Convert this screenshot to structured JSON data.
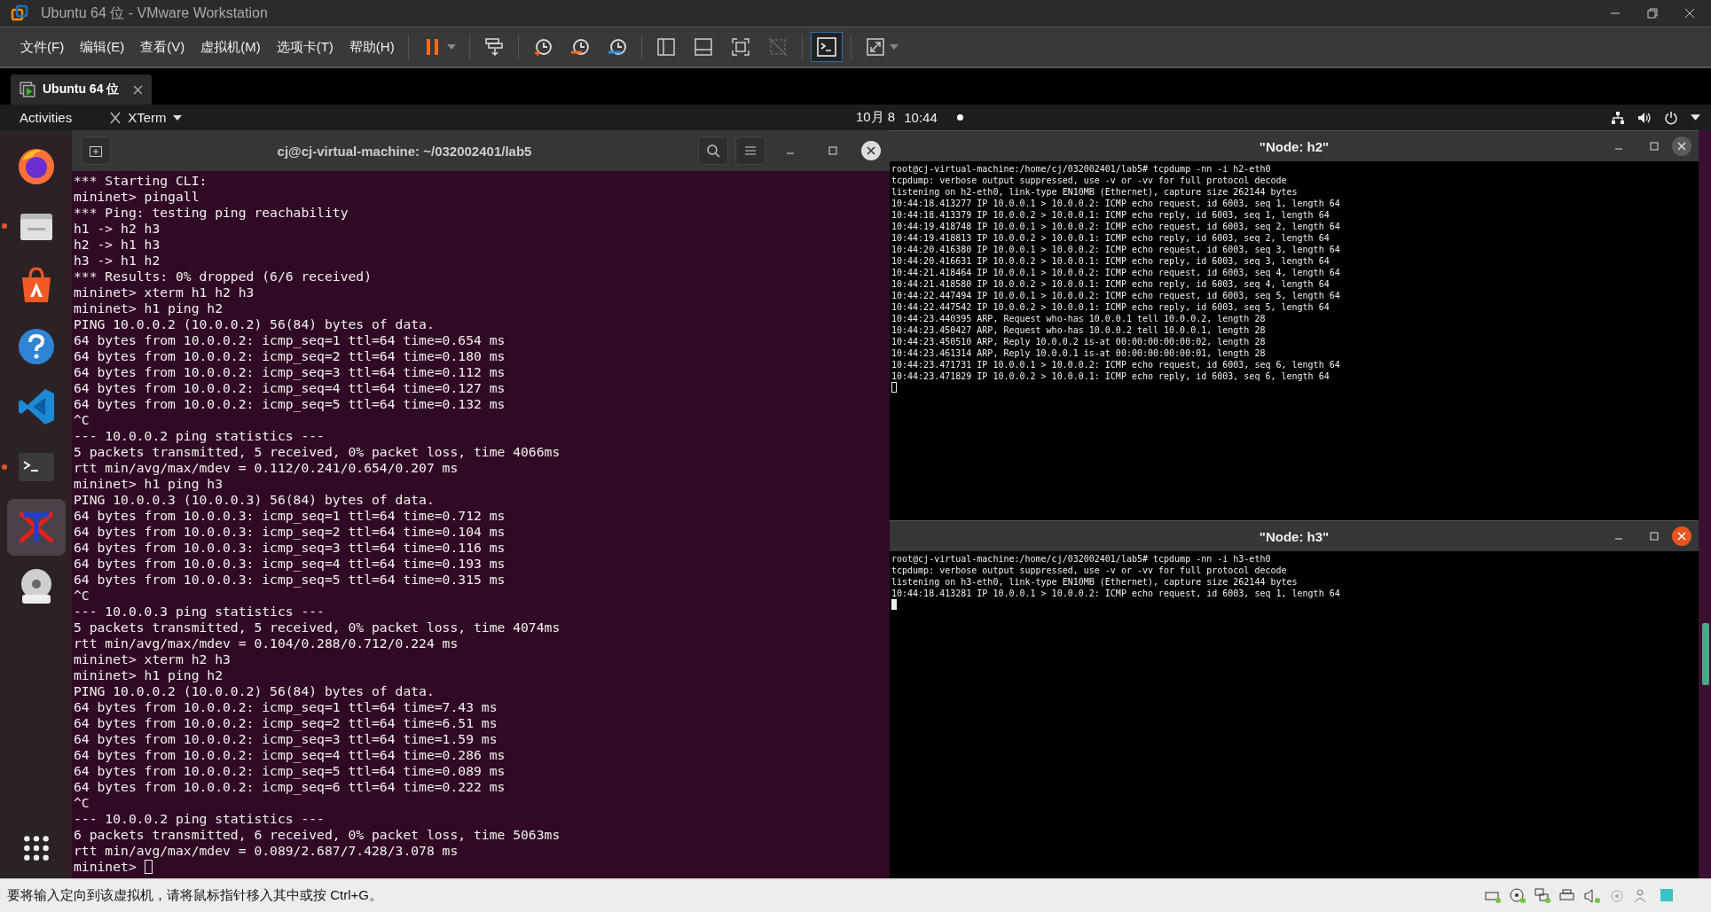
{
  "window": {
    "title": "Ubuntu 64 位 - VMware Workstation"
  },
  "menu": [
    "文件(F)",
    "编辑(E)",
    "查看(V)",
    "虚拟机(M)",
    "选项卡(T)",
    "帮助(H)"
  ],
  "toolbar_groups": [
    {
      "buttons": [
        {
          "kind": "pause",
          "selected": false,
          "dropdown": true
        }
      ]
    },
    {
      "buttons": [
        {
          "kind": "send-keys",
          "selected": false,
          "dropdown": false
        }
      ]
    },
    {
      "buttons": [
        {
          "kind": "snapshot-take",
          "selected": false,
          "dropdown": false
        },
        {
          "kind": "snapshot-revert",
          "selected": false,
          "dropdown": false
        },
        {
          "kind": "snapshot-manager",
          "selected": false,
          "dropdown": false
        }
      ]
    },
    {
      "buttons": [
        {
          "kind": "library",
          "selected": false,
          "dropdown": false
        },
        {
          "kind": "thumbnail",
          "selected": false,
          "dropdown": false
        },
        {
          "kind": "fullscreen",
          "selected": false,
          "dropdown": false
        },
        {
          "kind": "unity",
          "selected": false,
          "dropdown": false
        }
      ]
    },
    {
      "buttons": [
        {
          "kind": "console",
          "selected": true,
          "dropdown": false
        }
      ]
    },
    {
      "buttons": [
        {
          "kind": "stretch",
          "selected": false,
          "dropdown": true
        }
      ]
    }
  ],
  "vm_tabs": [
    {
      "label": "Ubuntu 64 位",
      "selected": true
    }
  ],
  "top_bar": {
    "activities": "Activities",
    "app": "XTerm",
    "date": "10月 8",
    "time": "10:44"
  },
  "dock": [
    {
      "kind": "firefox",
      "running": false,
      "selected": false
    },
    {
      "kind": "files",
      "running": true,
      "selected": false
    },
    {
      "kind": "software",
      "running": false,
      "selected": false
    },
    {
      "kind": "help",
      "running": false,
      "selected": false
    },
    {
      "kind": "vscode",
      "running": false,
      "selected": false
    },
    {
      "kind": "terminal",
      "running": true,
      "selected": false
    },
    {
      "kind": "xterm",
      "running": false,
      "selected": true
    },
    {
      "kind": "dvd",
      "running": false,
      "selected": false
    }
  ],
  "terminal": {
    "title": "cj@cj-virtual-machine: ~/032002401/lab5",
    "lines": [
      "*** Starting CLI:",
      "mininet> pingall",
      "*** Ping: testing ping reachability",
      "h1 -> h2 h3",
      "h2 -> h1 h3",
      "h3 -> h1 h2",
      "*** Results: 0% dropped (6/6 received)",
      "mininet> xterm h1 h2 h3",
      "mininet> h1 ping h2",
      "PING 10.0.0.2 (10.0.0.2) 56(84) bytes of data.",
      "64 bytes from 10.0.0.2: icmp_seq=1 ttl=64 time=0.654 ms",
      "64 bytes from 10.0.0.2: icmp_seq=2 ttl=64 time=0.180 ms",
      "64 bytes from 10.0.0.2: icmp_seq=3 ttl=64 time=0.112 ms",
      "64 bytes from 10.0.0.2: icmp_seq=4 ttl=64 time=0.127 ms",
      "64 bytes from 10.0.0.2: icmp_seq=5 ttl=64 time=0.132 ms",
      "^C",
      "--- 10.0.0.2 ping statistics ---",
      "5 packets transmitted, 5 received, 0% packet loss, time 4066ms",
      "rtt min/avg/max/mdev = 0.112/0.241/0.654/0.207 ms",
      "mininet> h1 ping h3",
      "PING 10.0.0.3 (10.0.0.3) 56(84) bytes of data.",
      "64 bytes from 10.0.0.3: icmp_seq=1 ttl=64 time=0.712 ms",
      "64 bytes from 10.0.0.3: icmp_seq=2 ttl=64 time=0.104 ms",
      "64 bytes from 10.0.0.3: icmp_seq=3 ttl=64 time=0.116 ms",
      "64 bytes from 10.0.0.3: icmp_seq=4 ttl=64 time=0.193 ms",
      "64 bytes from 10.0.0.3: icmp_seq=5 ttl=64 time=0.315 ms",
      "^C",
      "--- 10.0.0.3 ping statistics ---",
      "5 packets transmitted, 5 received, 0% packet loss, time 4074ms",
      "rtt min/avg/max/mdev = 0.104/0.288/0.712/0.224 ms",
      "mininet> xterm h2 h3",
      "mininet> h1 ping h2",
      "PING 10.0.0.2 (10.0.0.2) 56(84) bytes of data.",
      "64 bytes from 10.0.0.2: icmp_seq=1 ttl=64 time=7.43 ms",
      "64 bytes from 10.0.0.2: icmp_seq=2 ttl=64 time=6.51 ms",
      "64 bytes from 10.0.0.2: icmp_seq=3 ttl=64 time=1.59 ms",
      "64 bytes from 10.0.0.2: icmp_seq=4 ttl=64 time=0.286 ms",
      "64 bytes from 10.0.0.2: icmp_seq=5 ttl=64 time=0.089 ms",
      "64 bytes from 10.0.0.2: icmp_seq=6 ttl=64 time=0.222 ms",
      "^C",
      "--- 10.0.0.2 ping statistics ---",
      "6 packets transmitted, 6 received, 0% packet loss, time 5063ms",
      "rtt min/avg/max/mdev = 0.089/2.687/7.428/3.078 ms"
    ],
    "prompt": "mininet>"
  },
  "xterms": [
    {
      "title": "\"Node: h2\"",
      "focused": false,
      "lines": [
        "root@cj-virtual-machine:/home/cj/032002401/lab5# tcpdump -nn -i h2-eth0",
        "tcpdump: verbose output suppressed, use -v or -vv for full protocol decode",
        "listening on h2-eth0, link-type EN10MB (Ethernet), capture size 262144 bytes",
        "10:44:18.413277 IP 10.0.0.1 > 10.0.0.2: ICMP echo request, id 6003, seq 1, length 64",
        "10:44:18.413379 IP 10.0.0.2 > 10.0.0.1: ICMP echo reply, id 6003, seq 1, length 64",
        "10:44:19.418748 IP 10.0.0.1 > 10.0.0.2: ICMP echo request, id 6003, seq 2, length 64",
        "10:44:19.418813 IP 10.0.0.2 > 10.0.0.1: ICMP echo reply, id 6003, seq 2, length 64",
        "10:44:20.416380 IP 10.0.0.1 > 10.0.0.2: ICMP echo request, id 6003, seq 3, length 64",
        "10:44:20.416631 IP 10.0.0.2 > 10.0.0.1: ICMP echo reply, id 6003, seq 3, length 64",
        "10:44:21.418464 IP 10.0.0.1 > 10.0.0.2: ICMP echo request, id 6003, seq 4, length 64",
        "10:44:21.418580 IP 10.0.0.2 > 10.0.0.1: ICMP echo reply, id 6003, seq 4, length 64",
        "10:44:22.447494 IP 10.0.0.1 > 10.0.0.2: ICMP echo request, id 6003, seq 5, length 64",
        "10:44:22.447542 IP 10.0.0.2 > 10.0.0.1: ICMP echo reply, id 6003, seq 5, length 64",
        "10:44:23.440395 ARP, Request who-has 10.0.0.1 tell 10.0.0.2, length 28",
        "10:44:23.450427 ARP, Request who-has 10.0.0.2 tell 10.0.0.1, length 28",
        "10:44:23.450510 ARP, Reply 10.0.0.2 is-at 00:00:00:00:00:02, length 28",
        "10:44:23.461314 ARP, Reply 10.0.0.1 is-at 00:00:00:00:00:01, length 28",
        "10:44:23.471731 IP 10.0.0.1 > 10.0.0.2: ICMP echo request, id 6003, seq 6, length 64",
        "10:44:23.471829 IP 10.0.0.2 > 10.0.0.1: ICMP echo reply, id 6003, seq 6, length 64"
      ]
    },
    {
      "title": "\"Node: h3\"",
      "focused": true,
      "lines": [
        "root@cj-virtual-machine:/home/cj/032002401/lab5# tcpdump -nn -i h3-eth0",
        "tcpdump: verbose output suppressed, use -v or -vv for full protocol decode",
        "listening on h3-eth0, link-type EN10MB (Ethernet), capture size 262144 bytes",
        "10:44:18.413281 IP 10.0.0.1 > 10.0.0.2: ICMP echo request, id 6003, seq 1, length 64"
      ]
    }
  ],
  "status_bar": {
    "message": "要将输入定向到该虚拟机，请将鼠标指针移入其中或按 Ctrl+G。"
  }
}
